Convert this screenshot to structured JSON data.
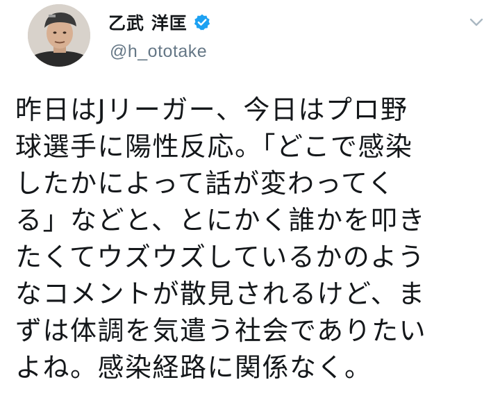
{
  "tweet": {
    "author": {
      "display_name": "乙武 洋匡",
      "handle": "@h_ototake",
      "verified": true,
      "avatar_icon": "avatar-photo-icon",
      "verified_icon": "verified-badge-icon"
    },
    "menu_icon": "chevron-down-icon",
    "text_lines": [
      "昨日はJリーガー、今日はプロ野",
      "球選手に陽性反応。「どこで感染",
      "したかによって話が変わってく",
      "る」などと、とにかく誰かを叩き",
      "たくてウズウズしているかのよう",
      "なコメントが散見されるけど、ま",
      "ずは体調を気遣う社会でありたい",
      "よね。感染経路に関係なく。"
    ]
  },
  "colors": {
    "text": "#14171a",
    "secondary_text": "#657786",
    "verified_blue": "#1da1f2",
    "caret": "#aab8c2"
  }
}
